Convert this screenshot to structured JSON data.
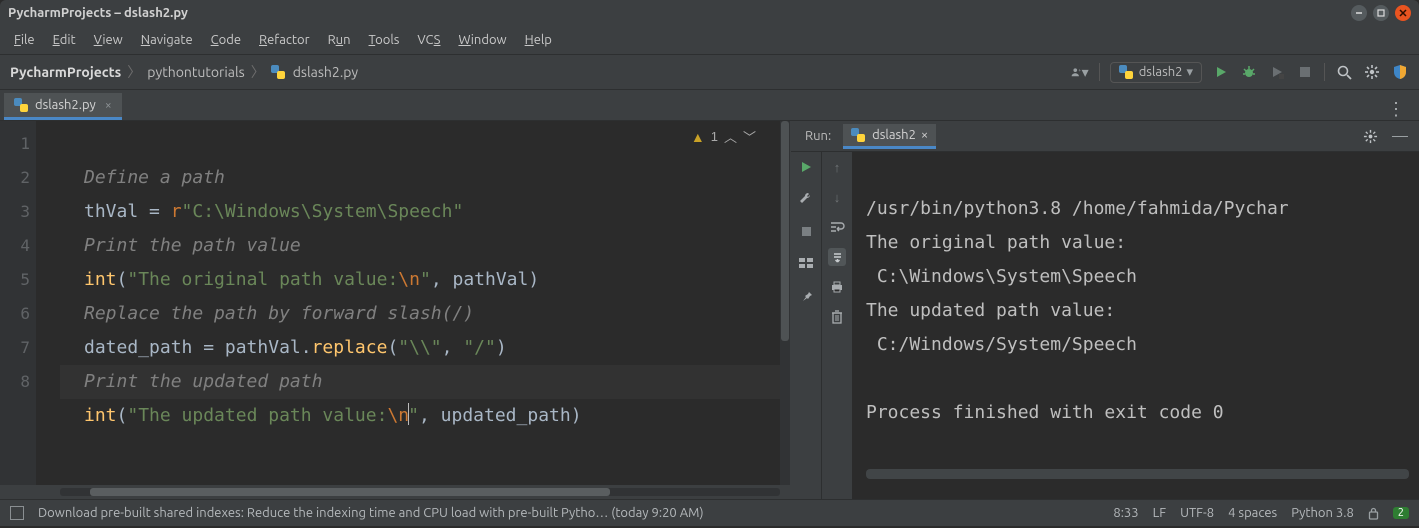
{
  "window": {
    "title": "PycharmProjects – dslash2.py"
  },
  "menu": {
    "file": "File",
    "edit": "Edit",
    "view": "View",
    "navigate": "Navigate",
    "code": "Code",
    "refactor": "Refactor",
    "run": "Run",
    "tools": "Tools",
    "vcs": "VCS",
    "window": "Window",
    "help": "Help"
  },
  "breadcrumbs": {
    "project": "PycharmProjects",
    "folder": "pythontutorials",
    "file": "dslash2.py"
  },
  "run_config": {
    "name": "dslash2"
  },
  "editor_tab": {
    "name": "dslash2.py"
  },
  "inspection": {
    "count": "1"
  },
  "code_lines": [
    "1",
    "2",
    "3",
    "4",
    "5",
    "6",
    "7",
    "8"
  ],
  "code_tokens": {
    "l1_comment": "Define a path",
    "l2_lhs": "thVal = ",
    "l2_prefix": "r",
    "l2_str": "\"C:\\Windows\\System\\Speech\"",
    "l3_comment": "Print the path value",
    "l4_fn": "int",
    "l4_str_a": "\"The original path value:",
    "l4_esc": "\\n",
    "l4_str_b": "\"",
    "l4_rest": ", pathVal)",
    "l5_comment": "Replace the path by forward slash(/)",
    "l6_lhs": "dated_path = pathVal.",
    "l6_fn": "replace",
    "l6_args_a": "(",
    "l6_str1": "\"\\\\\"",
    "l6_mid": ", ",
    "l6_str2": "\"/\"",
    "l6_args_b": ")",
    "l7_comment": "Print the updated path",
    "l8_fn": "int",
    "l8_str_a": "\"The updated path value:",
    "l8_esc": "\\n",
    "l8_str_b": "\"",
    "l8_rest": ", updated_path)"
  },
  "run_panel": {
    "title": "Run:",
    "tab": "dslash2"
  },
  "console_lines": {
    "cmd": "/usr/bin/python3.8 /home/fahmida/Pychar",
    "o1": "The original path value:",
    "o2": " C:\\Windows\\System\\Speech",
    "o3": "The updated path value:",
    "o4": " C:/Windows/System/Speech",
    "blank": "",
    "exit": "Process finished with exit code 0"
  },
  "status": {
    "msg": "Download pre-built shared indexes: Reduce the indexing time and CPU load with pre-built Pytho… (today 9:20 AM)",
    "pos": "8:33",
    "eol": "LF",
    "enc": "UTF-8",
    "indent": "4 spaces",
    "interp": "Python 3.8",
    "badge": "2"
  }
}
